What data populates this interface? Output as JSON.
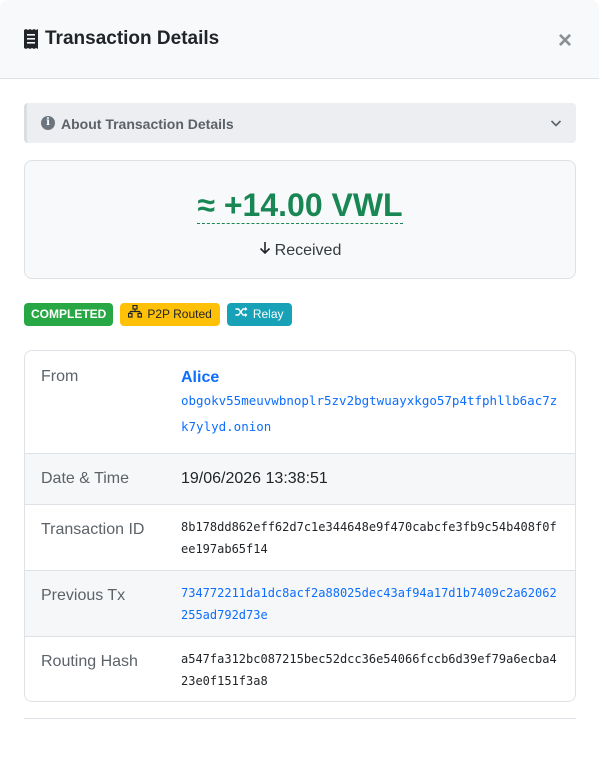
{
  "modal": {
    "title": "Transaction Details",
    "close_label": "×"
  },
  "accordion": {
    "label": "About Transaction Details"
  },
  "amount": {
    "value": "≈ +14.00 VWL",
    "direction": "Received",
    "color": "#198754"
  },
  "badges": {
    "status": "COMPLETED",
    "routing": "P2P Routed",
    "mode": "Relay"
  },
  "details": {
    "from": {
      "label": "From",
      "name": "Alice",
      "address": "obgokv55meuvwbnoplr5zv2bgtwuayxkgo57p4tfphllb6ac7zk7ylyd.onion"
    },
    "datetime": {
      "label": "Date & Time",
      "value": "19/06/2026 13:38:51"
    },
    "txid": {
      "label": "Transaction ID",
      "value": "8b178dd862eff62d7c1e344648e9f470cabcfe3fb9c54b408f0fee197ab65f14"
    },
    "prev_tx": {
      "label": "Previous Tx",
      "value": "734772211da1dc8acf2a88025dec43af94a17d1b7409c2a62062255ad792d73e"
    },
    "routing_hash": {
      "label": "Routing Hash",
      "value": "a547fa312bc087215bec52dcc36e54066fccb6d39ef79a6ecba423e0f151f3a8"
    }
  },
  "colors": {
    "success": "#28a745",
    "warning": "#ffc107",
    "info": "#17a2b8",
    "link": "#0d6efd"
  }
}
